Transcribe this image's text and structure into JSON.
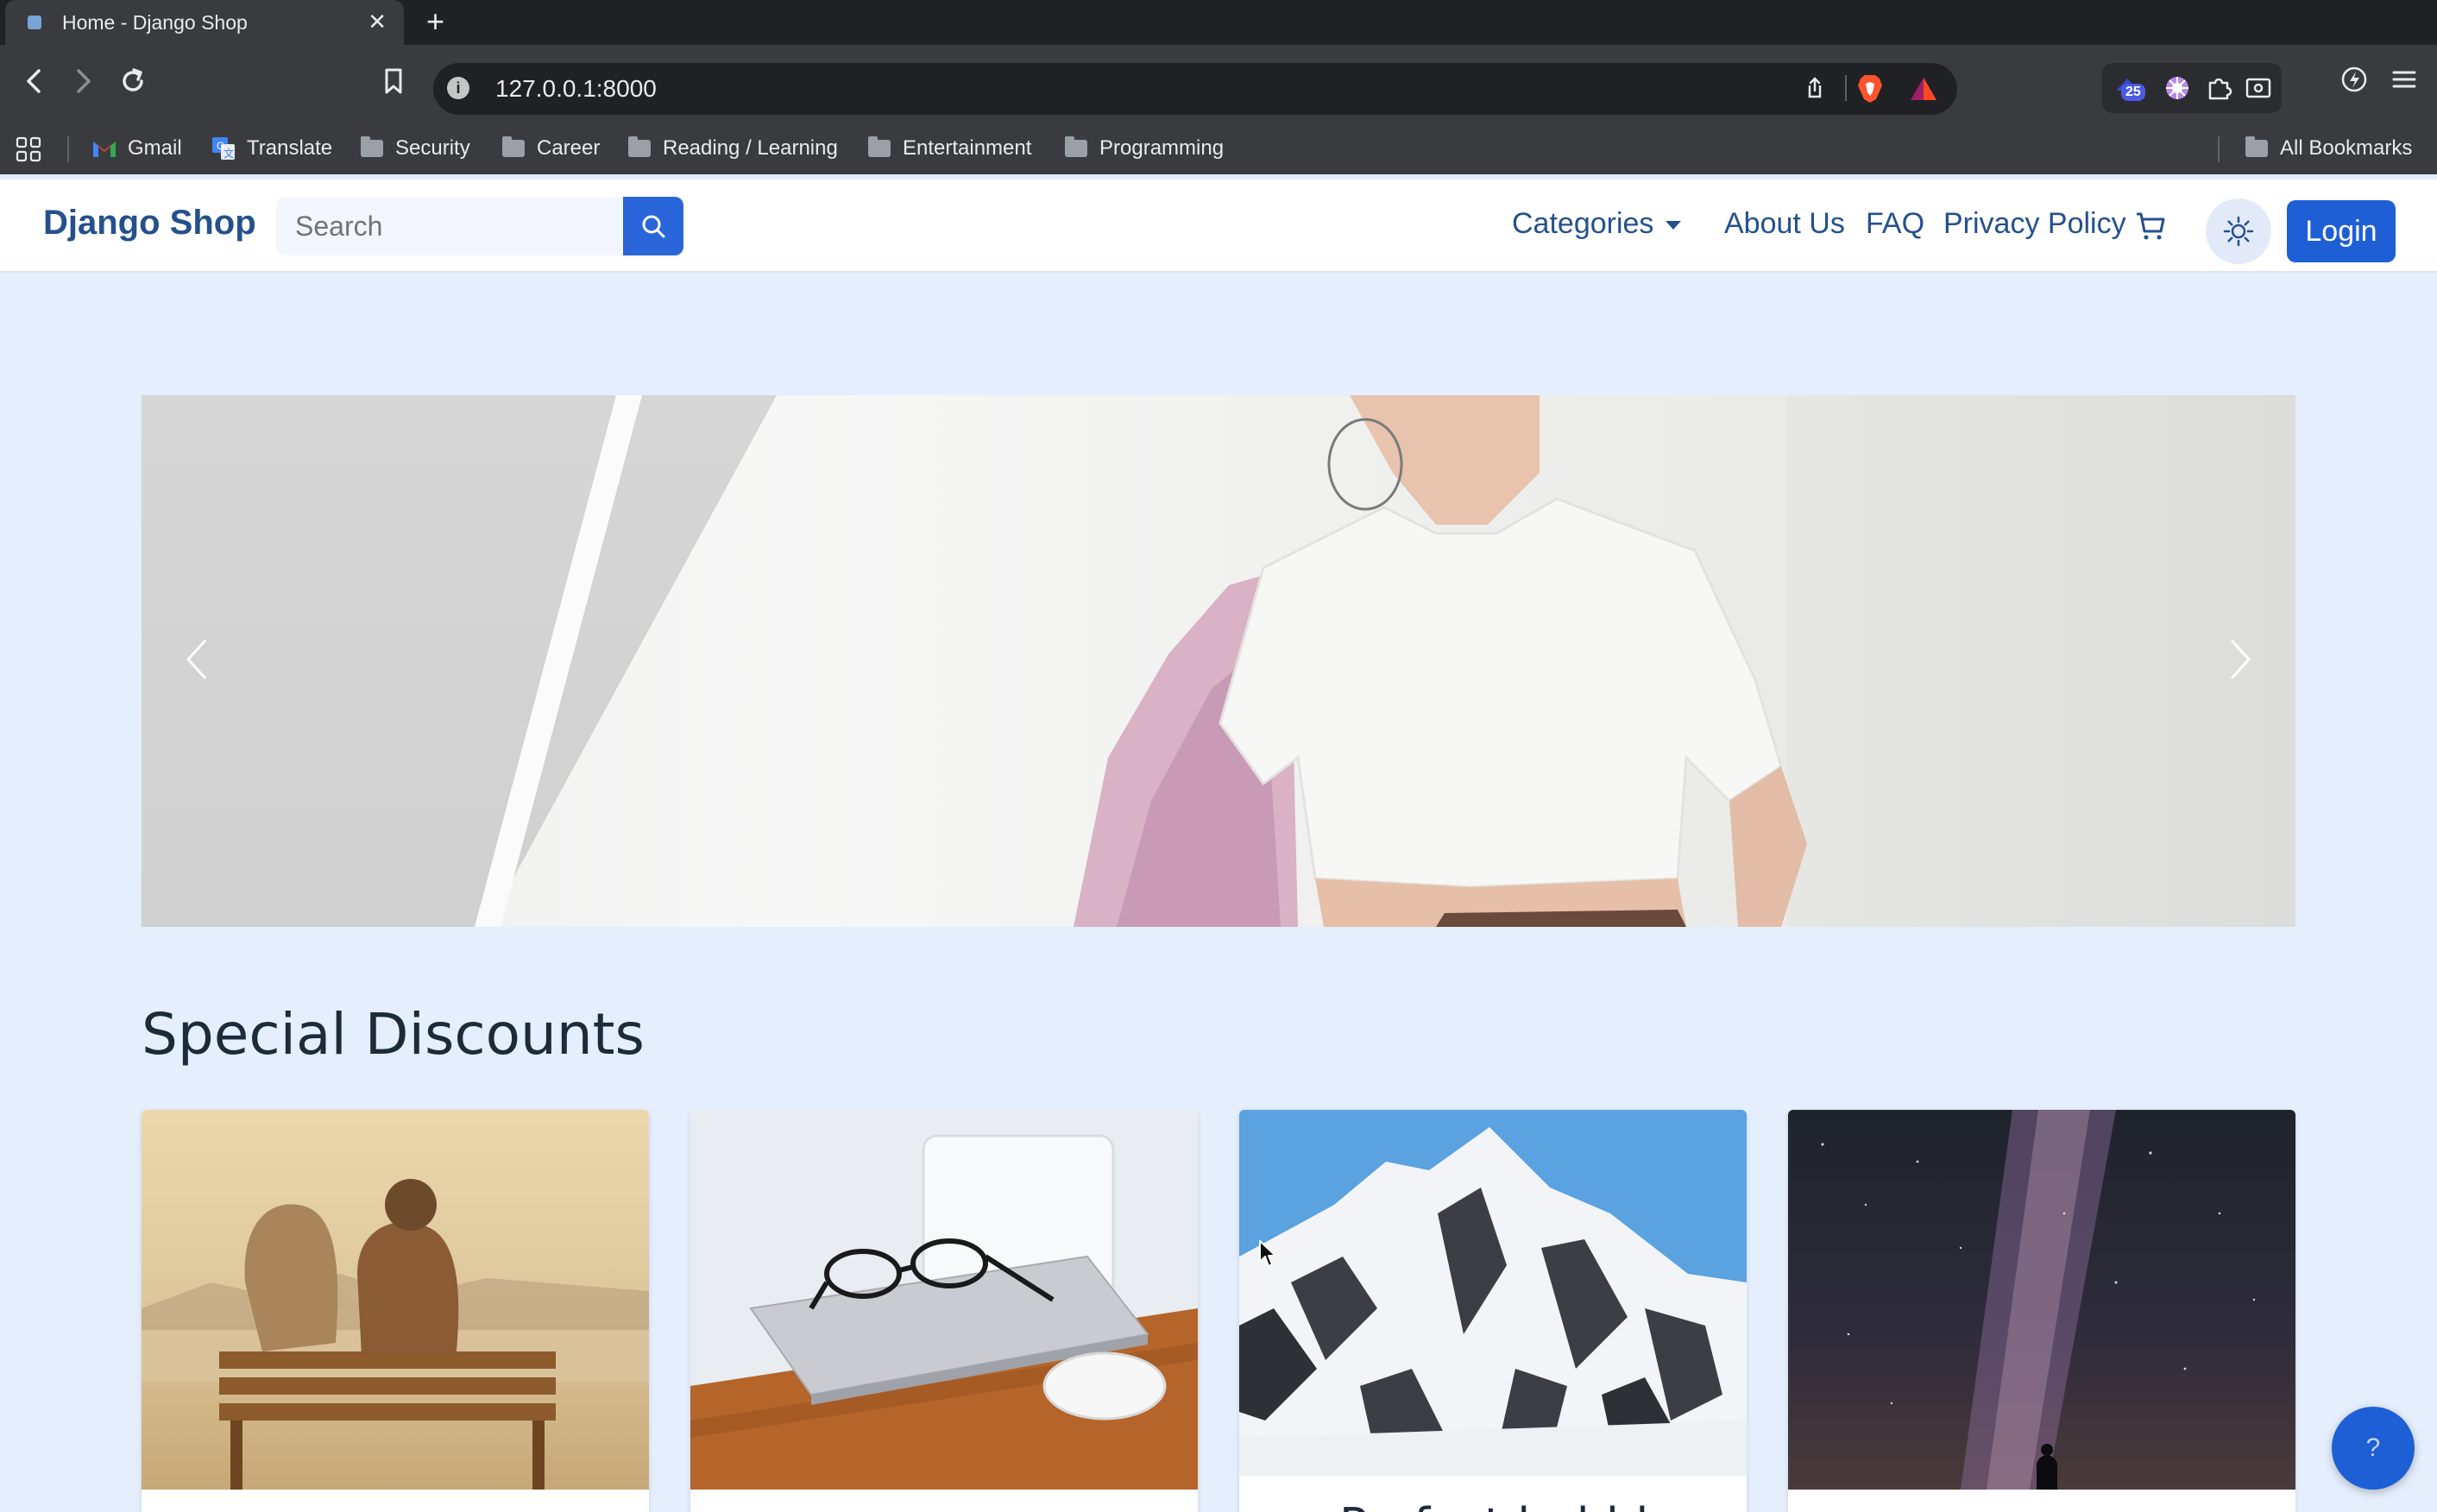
{
  "browser": {
    "tab_title": "Home - Django Shop",
    "url": "127.0.0.1:8000",
    "extension_badge": "25",
    "bookmarks": [
      "Gmail",
      "Translate",
      "Security",
      "Career",
      "Reading / Learning",
      "Entertainment",
      "Programming"
    ],
    "all_bookmarks": "All Bookmarks"
  },
  "navbar": {
    "brand": "Django Shop",
    "search_placeholder": "Search",
    "categories": "Categories",
    "about": "About Us",
    "faq": "FAQ",
    "privacy": "Privacy Policy",
    "login": "Login"
  },
  "discounts": {
    "title": "Special Discounts",
    "cards": [
      {
        "image": "couple-on-bench"
      },
      {
        "image": "glasses-on-laptop"
      },
      {
        "image": "snowy-mountain",
        "title": "Perfect bubble"
      },
      {
        "image": "starry-night-sky"
      }
    ]
  },
  "help": {
    "label": "?"
  },
  "colors": {
    "brand": "#24518c",
    "primary": "#1f5fd6",
    "page_bg": "#e4eefc"
  }
}
